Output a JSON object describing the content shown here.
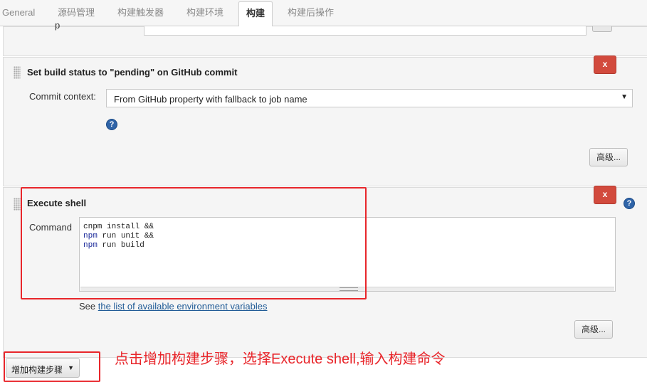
{
  "tabs": [
    {
      "label": "General",
      "active": false
    },
    {
      "label": "源码管理",
      "active": false
    },
    {
      "label": "构建触发器",
      "active": false
    },
    {
      "label": "构建环境",
      "active": false
    },
    {
      "label": "构建",
      "active": true
    },
    {
      "label": "构建后操作",
      "active": false
    }
  ],
  "previous_step": {
    "label_fragment": "p"
  },
  "github_status": {
    "title": "Set build status to \"pending\" on GitHub commit",
    "delete_label": "x",
    "commit_context_label": "Commit context:",
    "commit_context_value": "From GitHub property with fallback to job name",
    "help_icon": "question-circle-icon",
    "advanced_label": "高级..."
  },
  "execute_shell": {
    "title": "Execute shell",
    "delete_label": "x",
    "help_icon": "question-circle-icon",
    "command_label": "Command",
    "command_lines": [
      {
        "kw": "",
        "rest": "cnpm install &&"
      },
      {
        "kw": "npm",
        "rest": " run unit &&"
      },
      {
        "kw": "npm",
        "rest": " run build"
      }
    ],
    "see_prefix": "See ",
    "see_link": "the list of available environment variables",
    "advanced_label": "高级..."
  },
  "add_step": {
    "label": "增加构建步骤"
  },
  "annotation": "点击增加构建步骤，选择Execute shell,输入构建命令",
  "colors": {
    "highlight_red": "#e8262b",
    "delete_red": "#d24a3d",
    "link_blue": "#205b96",
    "help_blue": "#2f64a8"
  }
}
